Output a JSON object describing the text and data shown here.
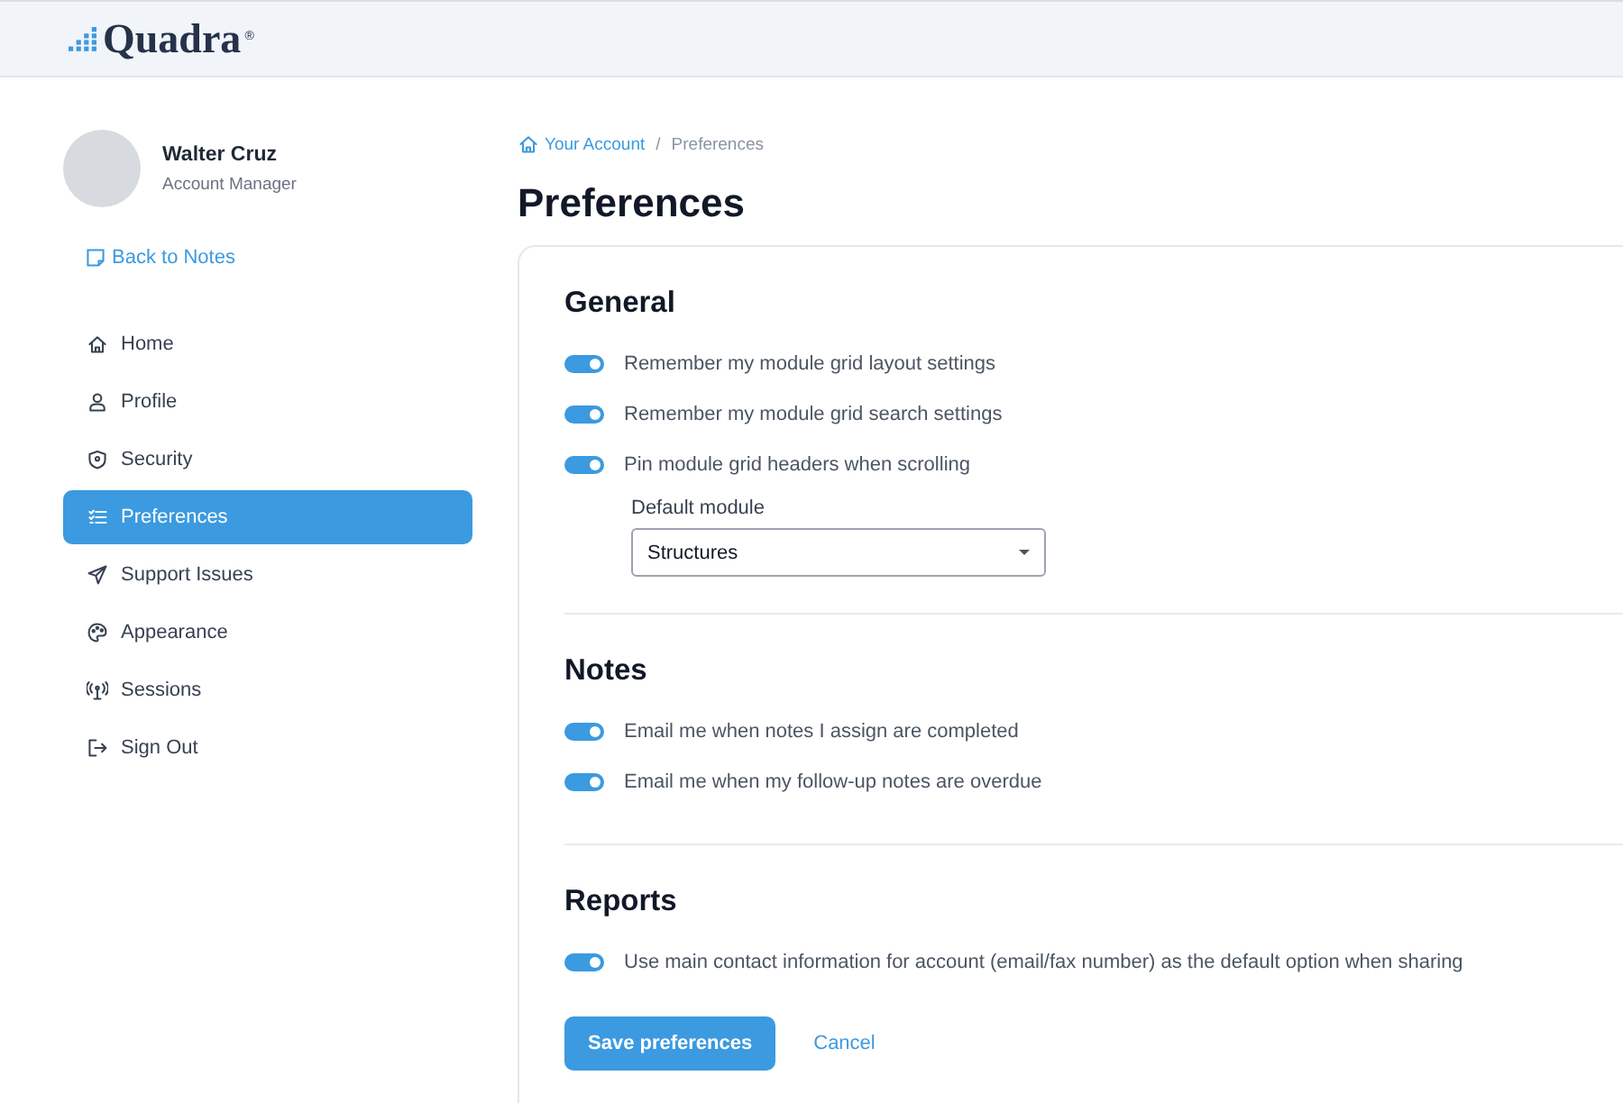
{
  "header": {
    "logo": "Quadra",
    "logo_mark": "®"
  },
  "sidebar": {
    "user": {
      "name": "Walter Cruz",
      "role": "Account Manager"
    },
    "back_link": "Back to Notes",
    "items": [
      {
        "label": "Home",
        "kind": "home",
        "selected": false
      },
      {
        "label": "Profile",
        "kind": "profile",
        "selected": false
      },
      {
        "label": "Security",
        "kind": "security",
        "selected": false
      },
      {
        "label": "Preferences",
        "kind": "preferences",
        "selected": true
      },
      {
        "label": "Support Issues",
        "kind": "support",
        "selected": false
      },
      {
        "label": "Appearance",
        "kind": "appearance",
        "selected": false
      },
      {
        "label": "Sessions",
        "kind": "sessions",
        "selected": false
      },
      {
        "label": "Sign Out",
        "kind": "signout",
        "selected": false
      }
    ]
  },
  "breadcrumb": [
    "Your Account",
    "/",
    "Preferences"
  ],
  "title": "Preferences",
  "sections": [
    {
      "heading": "General",
      "settings": [
        {
          "label": "Remember my module grid layout settings",
          "on": true
        },
        {
          "label": "Remember my module grid search settings",
          "on": true
        },
        {
          "label": "Pin module grid headers when scrolling",
          "on": true
        }
      ],
      "select": {
        "label": "Default module",
        "value": "Structures"
      }
    },
    {
      "heading": "Notes",
      "settings": [
        {
          "label": "Email me when notes I assign are completed",
          "on": true
        },
        {
          "label": "Email me when my follow-up notes are overdue",
          "on": true
        }
      ]
    },
    {
      "heading": "Reports",
      "settings": [
        {
          "label": "Use main contact information for account (email/fax number) as the default option when sharing",
          "on": true
        }
      ]
    }
  ],
  "buttons": {
    "save": "Save preferences",
    "cancel": "Cancel"
  }
}
